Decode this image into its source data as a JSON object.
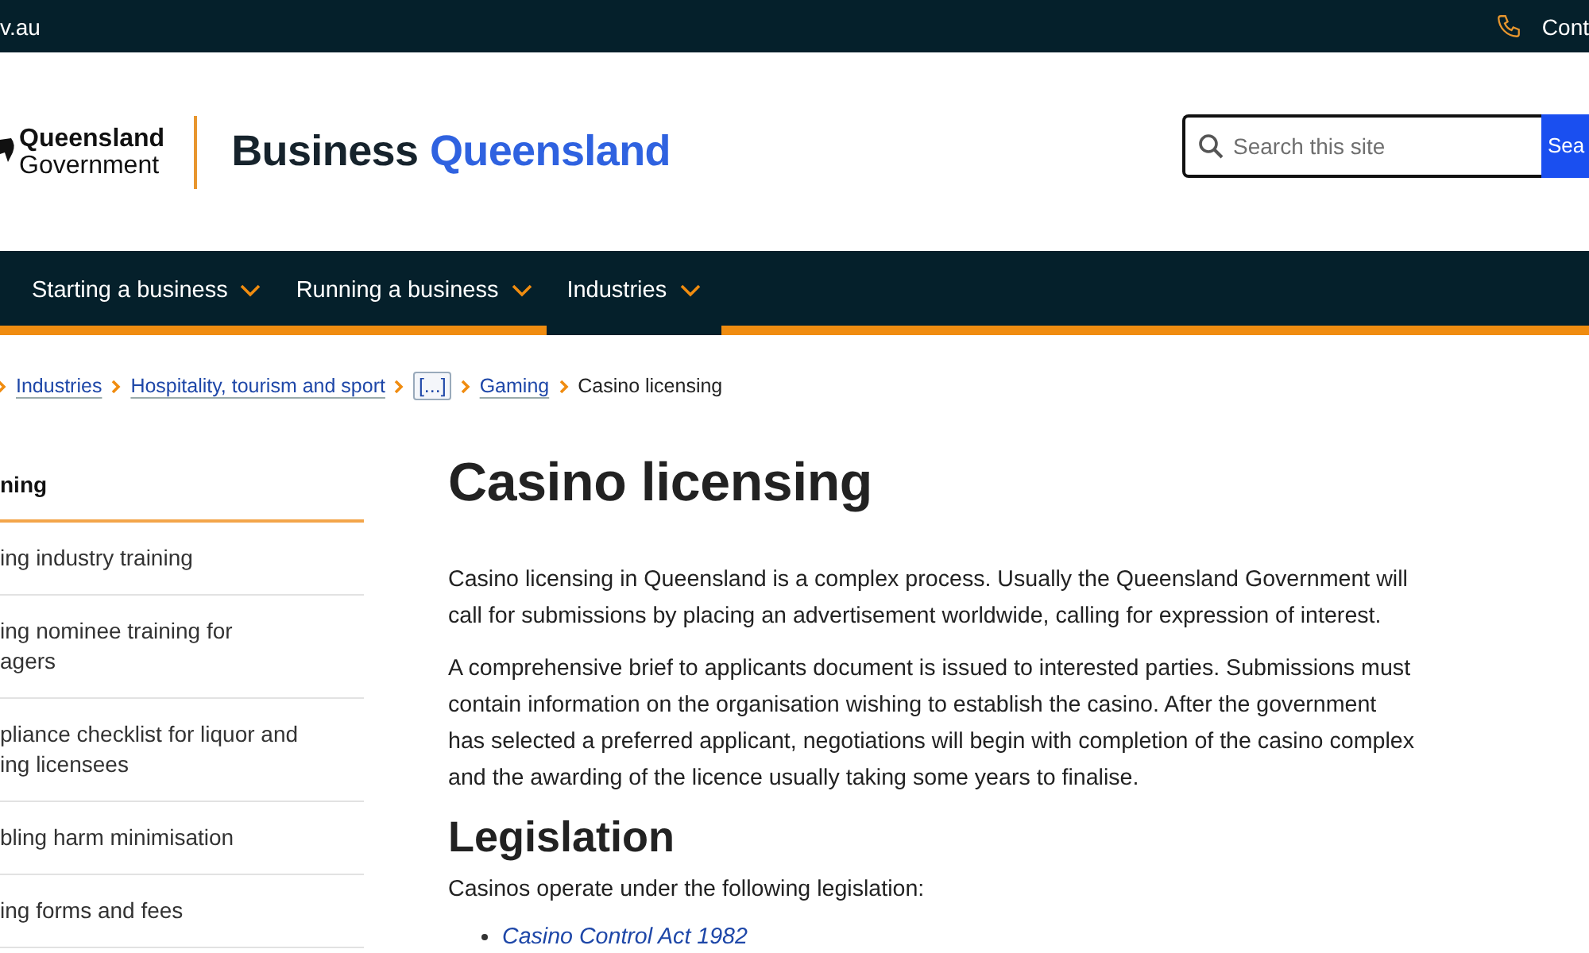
{
  "top_bar": {
    "site_link": "v.au",
    "contact": "Cont"
  },
  "header": {
    "logo_line_1": "Queensland",
    "logo_line_2": "Government",
    "site_title_1": "Business",
    "site_title_2": "Queensland",
    "search": {
      "placeholder": "Search this site"
    },
    "search_button": "Sea"
  },
  "nav": [
    {
      "label": "Starting a business",
      "selected": false
    },
    {
      "label": "Running a business",
      "selected": false
    },
    {
      "label": "Industries",
      "selected": true
    }
  ],
  "breadcrumbs": [
    {
      "label": "Industries",
      "kind": "link"
    },
    {
      "label": "Hospitality, tourism and sport",
      "kind": "link"
    },
    {
      "label": "[...]",
      "kind": "more"
    },
    {
      "label": "Gaming",
      "kind": "link"
    },
    {
      "label": "Casino licensing",
      "kind": "current"
    }
  ],
  "sidebar": {
    "heading": "ning",
    "items": [
      {
        "lines": [
          "ing industry training"
        ]
      },
      {
        "lines": [
          "ing nominee training for",
          "agers"
        ]
      },
      {
        "lines": [
          "pliance checklist for liquor and",
          "ing licensees"
        ]
      },
      {
        "lines": [
          "bling harm minimisation"
        ]
      },
      {
        "lines": [
          "ing forms and fees"
        ]
      }
    ]
  },
  "content": {
    "title": "Casino licensing",
    "paragraphs": [
      "Casino licensing in Queensland is a complex process. Usually the Queensland Government will call for submissions by placing an advertisement worldwide, calling for expression of interest.",
      "A comprehensive brief to applicants document is issued to interested parties. Submissions must contain information on the organisation wishing to establish the casino. After the government has selected a preferred applicant, negotiations will begin with completion of the casino complex and the awarding of the licence usually taking some years to finalise."
    ],
    "heading_2": "Legislation",
    "intro": "Casinos operate under the following legislation:",
    "list": [
      "Casino Control Act 1982"
    ]
  }
}
